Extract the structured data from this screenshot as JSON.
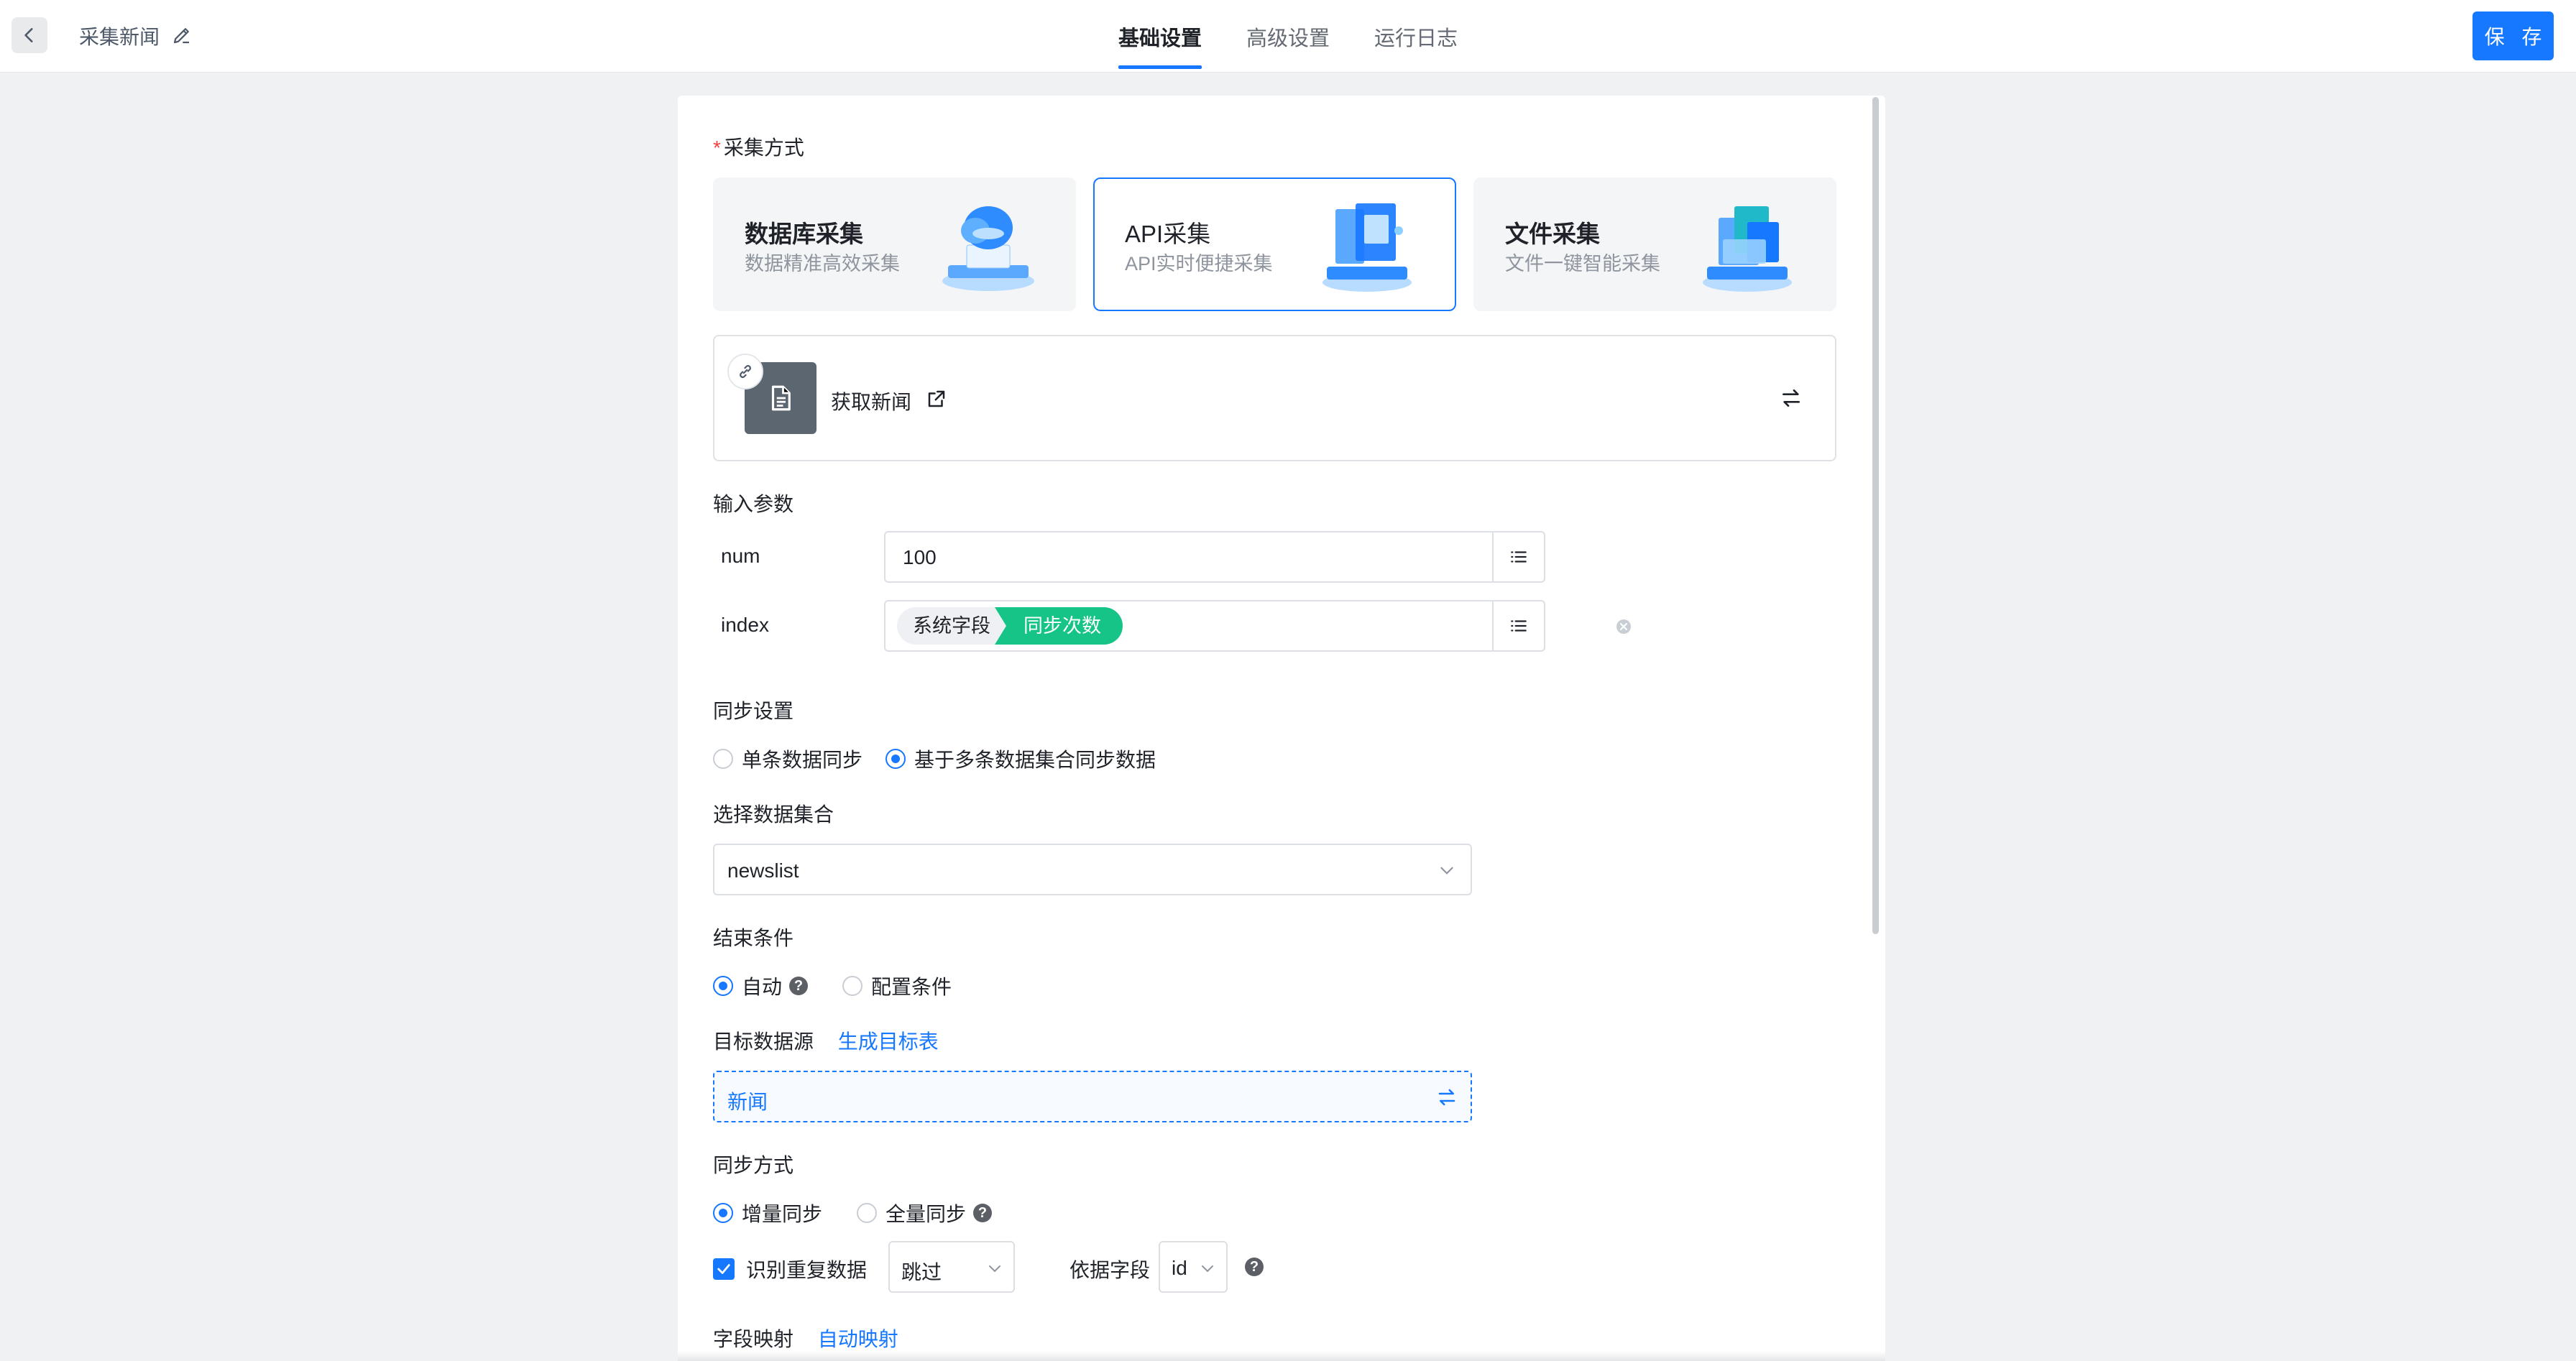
{
  "header": {
    "title": "采集新闻",
    "tabs": [
      {
        "label": "基础设置",
        "active": true
      },
      {
        "label": "高级设置",
        "active": false
      },
      {
        "label": "运行日志",
        "active": false
      }
    ],
    "save_label": "保 存"
  },
  "form": {
    "method_label": "采集方式",
    "methods": [
      {
        "title": "数据库采集",
        "subtitle": "数据精准高效采集",
        "selected": false
      },
      {
        "title": "API采集",
        "subtitle": "API实时便捷采集",
        "selected": true
      },
      {
        "title": "文件采集",
        "subtitle": "文件一键智能采集",
        "selected": false
      }
    ],
    "api": {
      "name": "获取新闻"
    },
    "input_params_label": "输入参数",
    "params": [
      {
        "name": "num",
        "value": "100"
      },
      {
        "name": "index",
        "tag_type": "系统字段",
        "tag_value": "同步次数"
      }
    ],
    "sync_settings": {
      "label": "同步设置",
      "options": [
        "单条数据同步",
        "基于多条数据集合同步数据"
      ],
      "selected_index": 1
    },
    "dataset": {
      "label": "选择数据集合",
      "value": "newslist"
    },
    "end_condition": {
      "label": "结束条件",
      "options": [
        "自动",
        "配置条件"
      ],
      "selected_index": 0
    },
    "target": {
      "label": "目标数据源",
      "link": "生成目标表",
      "value": "新闻"
    },
    "sync_mode": {
      "label": "同步方式",
      "options": [
        "增量同步",
        "全量同步"
      ],
      "selected_index": 0
    },
    "dedup": {
      "checkbox_label": "识别重复数据",
      "checked": true,
      "action": "跳过",
      "by_field_label": "依据字段",
      "field": "id"
    },
    "mapping": {
      "label": "字段映射",
      "link": "自动映射"
    }
  },
  "colors": {
    "primary": "#1677ff",
    "tag_green": "#17c488",
    "required": "#f53f3f"
  },
  "icons": [
    "back-arrow-icon",
    "edit-icon",
    "link-icon",
    "document-icon",
    "external-link-icon",
    "swap-icon",
    "list-icon",
    "clear-icon",
    "chevron-down-icon",
    "help-icon",
    "check-icon"
  ]
}
